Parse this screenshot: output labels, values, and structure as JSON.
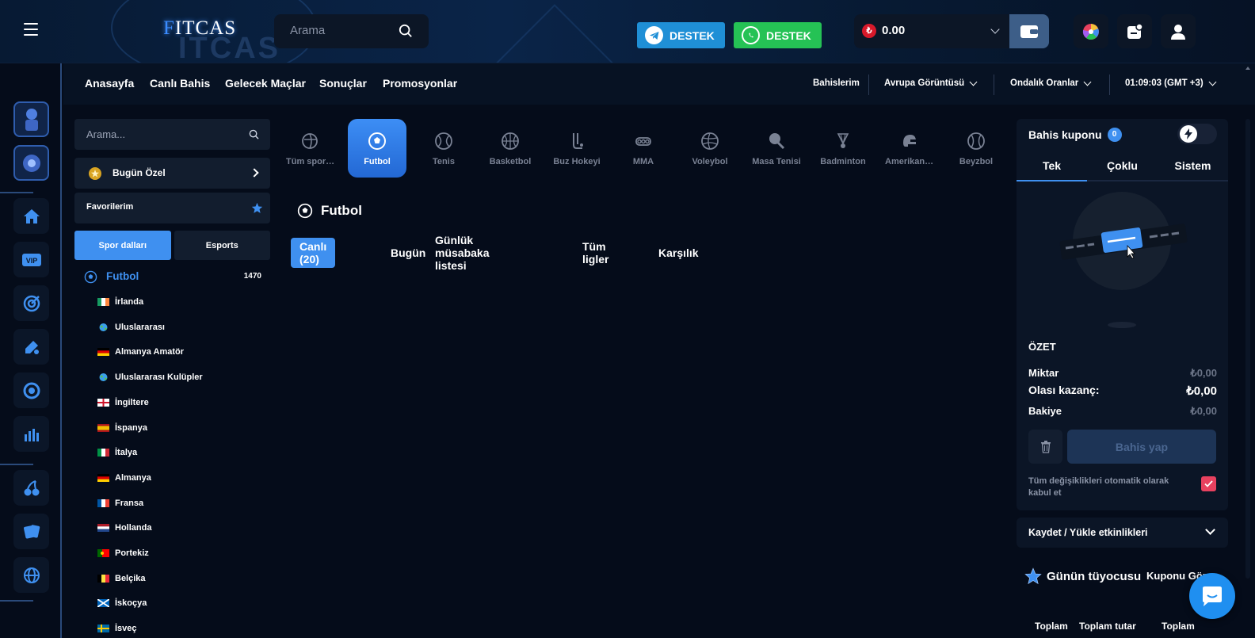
{
  "brand": {
    "logo_text": "ITCAS",
    "logo_mark": "F",
    "ghost_text": "ITCAS"
  },
  "header": {
    "search_placeholder": "Arama",
    "support_telegram": "DESTEK",
    "support_whatsapp": "DESTEK",
    "balance": "0.00",
    "currency_symbol": "₺"
  },
  "nav": {
    "links": [
      "Anasayfa",
      "Canlı Bahis",
      "Gelecek Maçlar",
      "Sonuçlar",
      "Promosyonlar"
    ],
    "my_bets": "Bahislerim",
    "view": "Avrupa Görüntüsü",
    "odds_format": "Ondalık Oranlar",
    "clock": "01:09:03 (GMT +3)"
  },
  "left_panel": {
    "search_placeholder": "Arama...",
    "today_special": "Bugün Özel",
    "favorites": "Favorilerim",
    "tab_sports": "Spor dalları",
    "tab_esports": "Esports",
    "sport_name": "Futbol",
    "sport_count": "1470",
    "countries": [
      {
        "name": "İrlanda",
        "flag": "ie"
      },
      {
        "name": "Uluslararası",
        "flag": "world"
      },
      {
        "name": "Almanya Amatör",
        "flag": "de"
      },
      {
        "name": "Uluslararası Kulüpler",
        "flag": "world"
      },
      {
        "name": "İngiltere",
        "flag": "en"
      },
      {
        "name": "İspanya",
        "flag": "es"
      },
      {
        "name": "İtalya",
        "flag": "it"
      },
      {
        "name": "Almanya",
        "flag": "de"
      },
      {
        "name": "Fransa",
        "flag": "fr"
      },
      {
        "name": "Hollanda",
        "flag": "nl"
      },
      {
        "name": "Portekiz",
        "flag": "pt"
      },
      {
        "name": "Belçika",
        "flag": "be"
      },
      {
        "name": "İskoçya",
        "flag": "sc"
      },
      {
        "name": "İsveç",
        "flag": "se"
      }
    ]
  },
  "sports": [
    {
      "label": "Tüm sporlar",
      "icon": "all-sports-icon",
      "active": false
    },
    {
      "label": "Futbol",
      "icon": "football-icon",
      "active": true
    },
    {
      "label": "Tenis",
      "icon": "tennis-icon",
      "active": false
    },
    {
      "label": "Basketbol",
      "icon": "basketball-icon",
      "active": false
    },
    {
      "label": "Buz Hokeyi",
      "icon": "ice-hockey-icon",
      "active": false
    },
    {
      "label": "MMA",
      "icon": "mma-icon",
      "active": false
    },
    {
      "label": "Voleybol",
      "icon": "volleyball-icon",
      "active": false
    },
    {
      "label": "Masa Tenisi",
      "icon": "table-tennis-icon",
      "active": false
    },
    {
      "label": "Badminton",
      "icon": "badminton-icon",
      "active": false
    },
    {
      "label": "Amerikan Futbolu",
      "icon": "american-football-icon",
      "active": false
    },
    {
      "label": "Beyzbol",
      "icon": "baseball-icon",
      "active": false
    }
  ],
  "main": {
    "section_title": "Futbol",
    "filters": [
      "Canlı (20)",
      "Bugün",
      "Günlük müsabaka listesi",
      "Tüm ligler",
      "Karşılık"
    ]
  },
  "betslip": {
    "title": "Bahis kuponu",
    "count": "0",
    "tabs": [
      "Tek",
      "Çoklu",
      "Sistem"
    ],
    "summary_title": "ÖZET",
    "amount_label": "Miktar",
    "amount_value": "₺0,00",
    "win_label": "Olası kazanç:",
    "win_value": "₺0,00",
    "balance_label": "Bakiye",
    "balance_value": "₺0,00",
    "place_bet": "Bahis yap",
    "auto_accept": "Tüm değişiklikleri otomatik olarak kabul et",
    "save_load": "Kaydet / Yükle etkinlikleri"
  },
  "tipster": {
    "title": "Günün tüyocusu",
    "tab": "Kuponu Gör",
    "cols": [
      "Toplam",
      "Toplam tutar",
      "Toplam"
    ]
  },
  "colors": {
    "accent": "#3f90f0",
    "telegram": "#1f8fd6",
    "whatsapp": "#25c255",
    "bg": "#050c1a"
  }
}
